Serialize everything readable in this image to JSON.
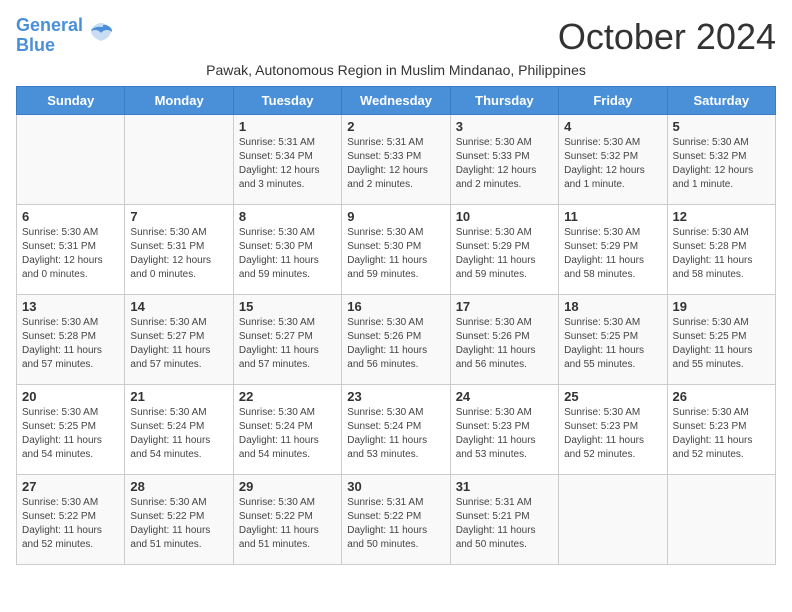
{
  "header": {
    "logo_line1": "General",
    "logo_line2": "Blue",
    "month_year": "October 2024",
    "subtitle": "Pawak, Autonomous Region in Muslim Mindanao, Philippines"
  },
  "weekdays": [
    "Sunday",
    "Monday",
    "Tuesday",
    "Wednesday",
    "Thursday",
    "Friday",
    "Saturday"
  ],
  "weeks": [
    [
      {
        "day": "",
        "info": ""
      },
      {
        "day": "",
        "info": ""
      },
      {
        "day": "1",
        "info": "Sunrise: 5:31 AM\nSunset: 5:34 PM\nDaylight: 12 hours and 3 minutes."
      },
      {
        "day": "2",
        "info": "Sunrise: 5:31 AM\nSunset: 5:33 PM\nDaylight: 12 hours and 2 minutes."
      },
      {
        "day": "3",
        "info": "Sunrise: 5:30 AM\nSunset: 5:33 PM\nDaylight: 12 hours and 2 minutes."
      },
      {
        "day": "4",
        "info": "Sunrise: 5:30 AM\nSunset: 5:32 PM\nDaylight: 12 hours and 1 minute."
      },
      {
        "day": "5",
        "info": "Sunrise: 5:30 AM\nSunset: 5:32 PM\nDaylight: 12 hours and 1 minute."
      }
    ],
    [
      {
        "day": "6",
        "info": "Sunrise: 5:30 AM\nSunset: 5:31 PM\nDaylight: 12 hours and 0 minutes."
      },
      {
        "day": "7",
        "info": "Sunrise: 5:30 AM\nSunset: 5:31 PM\nDaylight: 12 hours and 0 minutes."
      },
      {
        "day": "8",
        "info": "Sunrise: 5:30 AM\nSunset: 5:30 PM\nDaylight: 11 hours and 59 minutes."
      },
      {
        "day": "9",
        "info": "Sunrise: 5:30 AM\nSunset: 5:30 PM\nDaylight: 11 hours and 59 minutes."
      },
      {
        "day": "10",
        "info": "Sunrise: 5:30 AM\nSunset: 5:29 PM\nDaylight: 11 hours and 59 minutes."
      },
      {
        "day": "11",
        "info": "Sunrise: 5:30 AM\nSunset: 5:29 PM\nDaylight: 11 hours and 58 minutes."
      },
      {
        "day": "12",
        "info": "Sunrise: 5:30 AM\nSunset: 5:28 PM\nDaylight: 11 hours and 58 minutes."
      }
    ],
    [
      {
        "day": "13",
        "info": "Sunrise: 5:30 AM\nSunset: 5:28 PM\nDaylight: 11 hours and 57 minutes."
      },
      {
        "day": "14",
        "info": "Sunrise: 5:30 AM\nSunset: 5:27 PM\nDaylight: 11 hours and 57 minutes."
      },
      {
        "day": "15",
        "info": "Sunrise: 5:30 AM\nSunset: 5:27 PM\nDaylight: 11 hours and 57 minutes."
      },
      {
        "day": "16",
        "info": "Sunrise: 5:30 AM\nSunset: 5:26 PM\nDaylight: 11 hours and 56 minutes."
      },
      {
        "day": "17",
        "info": "Sunrise: 5:30 AM\nSunset: 5:26 PM\nDaylight: 11 hours and 56 minutes."
      },
      {
        "day": "18",
        "info": "Sunrise: 5:30 AM\nSunset: 5:25 PM\nDaylight: 11 hours and 55 minutes."
      },
      {
        "day": "19",
        "info": "Sunrise: 5:30 AM\nSunset: 5:25 PM\nDaylight: 11 hours and 55 minutes."
      }
    ],
    [
      {
        "day": "20",
        "info": "Sunrise: 5:30 AM\nSunset: 5:25 PM\nDaylight: 11 hours and 54 minutes."
      },
      {
        "day": "21",
        "info": "Sunrise: 5:30 AM\nSunset: 5:24 PM\nDaylight: 11 hours and 54 minutes."
      },
      {
        "day": "22",
        "info": "Sunrise: 5:30 AM\nSunset: 5:24 PM\nDaylight: 11 hours and 54 minutes."
      },
      {
        "day": "23",
        "info": "Sunrise: 5:30 AM\nSunset: 5:24 PM\nDaylight: 11 hours and 53 minutes."
      },
      {
        "day": "24",
        "info": "Sunrise: 5:30 AM\nSunset: 5:23 PM\nDaylight: 11 hours and 53 minutes."
      },
      {
        "day": "25",
        "info": "Sunrise: 5:30 AM\nSunset: 5:23 PM\nDaylight: 11 hours and 52 minutes."
      },
      {
        "day": "26",
        "info": "Sunrise: 5:30 AM\nSunset: 5:23 PM\nDaylight: 11 hours and 52 minutes."
      }
    ],
    [
      {
        "day": "27",
        "info": "Sunrise: 5:30 AM\nSunset: 5:22 PM\nDaylight: 11 hours and 52 minutes."
      },
      {
        "day": "28",
        "info": "Sunrise: 5:30 AM\nSunset: 5:22 PM\nDaylight: 11 hours and 51 minutes."
      },
      {
        "day": "29",
        "info": "Sunrise: 5:30 AM\nSunset: 5:22 PM\nDaylight: 11 hours and 51 minutes."
      },
      {
        "day": "30",
        "info": "Sunrise: 5:31 AM\nSunset: 5:22 PM\nDaylight: 11 hours and 50 minutes."
      },
      {
        "day": "31",
        "info": "Sunrise: 5:31 AM\nSunset: 5:21 PM\nDaylight: 11 hours and 50 minutes."
      },
      {
        "day": "",
        "info": ""
      },
      {
        "day": "",
        "info": ""
      }
    ]
  ]
}
